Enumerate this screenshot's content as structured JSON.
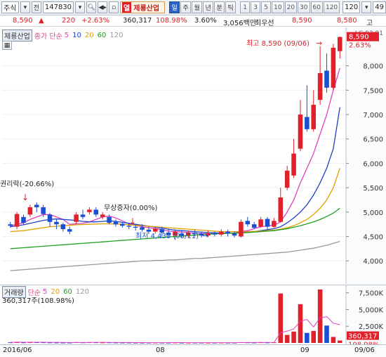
{
  "toolbar": {
    "market_select": "주식",
    "prev_label": "전",
    "code_value": "147830",
    "name_prefix": "열",
    "name_value": "제룡산업",
    "periods": [
      "일",
      "주",
      "월",
      "년",
      "분",
      "틱"
    ],
    "active_period": "일",
    "intervals": [
      "1",
      "3",
      "5",
      "10",
      "20",
      "30",
      "60",
      "120"
    ],
    "interval_select": "120",
    "count_value": "49"
  },
  "quote": {
    "price": "8,590",
    "change_arrow": "▲",
    "change": "220",
    "change_pct": "+2.63%",
    "volume": "360,317",
    "volume_ratio": "108.98%",
    "turnover": "3.60%",
    "amount": "3,056백만",
    "best_ask_label": "최우선",
    "best_ask": "8,590",
    "best_bid": "8,580",
    "high_label": "고"
  },
  "price_pane": {
    "legend_name": "제룡산업",
    "ma_label": "종가 단순",
    "ma_periods": [
      {
        "label": "5",
        "color": "#e040c0"
      },
      {
        "label": "10",
        "color": "#2040c0"
      },
      {
        "label": "20",
        "color": "#e0a000"
      },
      {
        "label": "60",
        "color": "#20a020"
      },
      {
        "label": "120",
        "color": "#999999"
      }
    ],
    "annotations": {
      "high": "최고 8,590 (09/06)",
      "low": "최저 4,430 (08/11)",
      "rights": "권리락(-20.66%)",
      "bonus": "무상증자(0.00%)"
    },
    "last_price_tag": "8,590",
    "last_pct_tag": "2.63%",
    "lc_tag": "LC:93.91"
  },
  "volume_pane": {
    "legend_name": "거래량",
    "ma_label": "단순",
    "ma_periods": [
      {
        "label": "5",
        "color": "#e040c0"
      },
      {
        "label": "20",
        "color": "#e0a000"
      },
      {
        "label": "60",
        "color": "#20a020"
      },
      {
        "label": "120",
        "color": "#999999"
      }
    ],
    "volume_text": "360,317주(108.98%)",
    "last_volume_tag": "360,317",
    "last_ratio_tag": "108.98%"
  },
  "x_axis": {
    "labels": [
      "2016/06",
      "08",
      "09",
      "09/06"
    ]
  },
  "chart_data": [
    {
      "type": "candlestick",
      "title": "제룡산업",
      "y_ticks": [
        4000,
        4500,
        5000,
        5500,
        6000,
        6500,
        7000,
        7500,
        8000
      ],
      "y_tick_labels": [
        "4,000",
        "4,500",
        "5,000",
        "5,500",
        "6,000",
        "6,500",
        "7,000",
        "7,500",
        "8,000"
      ],
      "ylim": [
        3600,
        8700
      ],
      "candles": [
        {
          "o": 4750,
          "c": 4720,
          "h": 4800,
          "l": 4680
        },
        {
          "o": 4700,
          "c": 4960,
          "h": 5000,
          "l": 4650
        },
        {
          "o": 4900,
          "c": 4780,
          "h": 4950,
          "l": 4750
        },
        {
          "o": 4950,
          "c": 5100,
          "h": 5150,
          "l": 4900
        },
        {
          "o": 5150,
          "c": 5100,
          "h": 5200,
          "l": 5000
        },
        {
          "o": 5100,
          "c": 4960,
          "h": 5150,
          "l": 4900
        },
        {
          "o": 4950,
          "c": 4800,
          "h": 4980,
          "l": 4700
        },
        {
          "o": 4800,
          "c": 4750,
          "h": 4850,
          "l": 4650
        },
        {
          "o": 4750,
          "c": 4650,
          "h": 4780,
          "l": 4600
        },
        {
          "o": 4650,
          "c": 4600,
          "h": 4700,
          "l": 4550
        },
        {
          "o": 4800,
          "c": 4950,
          "h": 5000,
          "l": 4750
        },
        {
          "o": 4950,
          "c": 4900,
          "h": 5050,
          "l": 4850
        },
        {
          "o": 5000,
          "c": 5050,
          "h": 5100,
          "l": 4950
        },
        {
          "o": 5050,
          "c": 4950,
          "h": 5100,
          "l": 4900
        },
        {
          "o": 4900,
          "c": 4950,
          "h": 5000,
          "l": 4850
        },
        {
          "o": 4900,
          "c": 4780,
          "h": 4950,
          "l": 4750
        },
        {
          "o": 4800,
          "c": 4750,
          "h": 4850,
          "l": 4700
        },
        {
          "o": 4760,
          "c": 4720,
          "h": 4800,
          "l": 4680
        },
        {
          "o": 4720,
          "c": 4700,
          "h": 4780,
          "l": 4650
        },
        {
          "o": 4700,
          "c": 4680,
          "h": 4760,
          "l": 4620
        },
        {
          "o": 4690,
          "c": 4640,
          "h": 4750,
          "l": 4600
        },
        {
          "o": 4640,
          "c": 4600,
          "h": 4700,
          "l": 4550
        },
        {
          "o": 4600,
          "c": 4660,
          "h": 4700,
          "l": 4560
        },
        {
          "o": 4650,
          "c": 4580,
          "h": 4700,
          "l": 4500
        },
        {
          "o": 4580,
          "c": 4530,
          "h": 4650,
          "l": 4480
        },
        {
          "o": 4520,
          "c": 4600,
          "h": 4650,
          "l": 4430
        },
        {
          "o": 4560,
          "c": 4520,
          "h": 4620,
          "l": 4470
        },
        {
          "o": 4530,
          "c": 4580,
          "h": 4620,
          "l": 4480
        },
        {
          "o": 4580,
          "c": 4560,
          "h": 4640,
          "l": 4500
        },
        {
          "o": 4560,
          "c": 4520,
          "h": 4600,
          "l": 4480
        },
        {
          "o": 4520,
          "c": 4560,
          "h": 4620,
          "l": 4490
        },
        {
          "o": 4560,
          "c": 4540,
          "h": 4600,
          "l": 4500
        },
        {
          "o": 4540,
          "c": 4600,
          "h": 4650,
          "l": 4500
        },
        {
          "o": 4600,
          "c": 4560,
          "h": 4640,
          "l": 4500
        },
        {
          "o": 4560,
          "c": 4520,
          "h": 4600,
          "l": 4480
        },
        {
          "o": 4500,
          "c": 4800,
          "h": 4850,
          "l": 4480
        },
        {
          "o": 4820,
          "c": 4750,
          "h": 4900,
          "l": 4700
        },
        {
          "o": 4750,
          "c": 4680,
          "h": 4800,
          "l": 4650
        },
        {
          "o": 4700,
          "c": 4850,
          "h": 4900,
          "l": 4680
        },
        {
          "o": 4860,
          "c": 4700,
          "h": 4900,
          "l": 4650
        },
        {
          "o": 4700,
          "c": 4820,
          "h": 4880,
          "l": 4680
        },
        {
          "o": 4800,
          "c": 5300,
          "h": 5500,
          "l": 4790
        },
        {
          "o": 5500,
          "c": 5850,
          "h": 5950,
          "l": 5450
        },
        {
          "o": 5750,
          "c": 6200,
          "h": 6500,
          "l": 5700
        },
        {
          "o": 6300,
          "c": 7000,
          "h": 7300,
          "l": 6250
        },
        {
          "o": 6950,
          "c": 6700,
          "h": 7600,
          "l": 6650
        },
        {
          "o": 6700,
          "c": 7200,
          "h": 7500,
          "l": 6650
        },
        {
          "o": 7300,
          "c": 7850,
          "h": 8400,
          "l": 7200
        },
        {
          "o": 7900,
          "c": 7550,
          "h": 8250,
          "l": 7450
        },
        {
          "o": 7550,
          "c": 8370,
          "h": 8450,
          "l": 7500
        },
        {
          "o": 8300,
          "c": 8590,
          "h": 8600,
          "l": 8150
        }
      ],
      "series": [
        {
          "name": "5",
          "values": [
            4720,
            4750,
            4780,
            4850,
            4900,
            4950,
            4950,
            4900,
            4850,
            4750,
            4760,
            4770,
            4800,
            4850,
            4900,
            4920,
            4880,
            4820,
            4760,
            4730,
            4700,
            4680,
            4660,
            4640,
            4610,
            4600,
            4590,
            4580,
            4570,
            4560,
            4560,
            4555,
            4560,
            4570,
            4570,
            4600,
            4620,
            4660,
            4700,
            4720,
            4730,
            4800,
            5000,
            5250,
            5600,
            5900,
            6200,
            6600,
            7000,
            7500,
            7950
          ]
        },
        {
          "name": "10",
          "values": [
            4700,
            4720,
            4740,
            4770,
            4800,
            4830,
            4850,
            4860,
            4850,
            4840,
            4830,
            4810,
            4800,
            4800,
            4810,
            4820,
            4810,
            4790,
            4770,
            4750,
            4730,
            4710,
            4690,
            4670,
            4650,
            4630,
            4620,
            4610,
            4600,
            4590,
            4580,
            4575,
            4570,
            4570,
            4570,
            4580,
            4590,
            4600,
            4620,
            4640,
            4660,
            4700,
            4780,
            4880,
            5000,
            5150,
            5350,
            5600,
            5900,
            6300,
            7150
          ]
        },
        {
          "name": "20",
          "values": [
            4600,
            4610,
            4620,
            4640,
            4660,
            4680,
            4700,
            4710,
            4720,
            4730,
            4740,
            4745,
            4750,
            4755,
            4760,
            4760,
            4755,
            4750,
            4740,
            4730,
            4720,
            4710,
            4700,
            4690,
            4680,
            4670,
            4660,
            4650,
            4640,
            4630,
            4620,
            4610,
            4600,
            4600,
            4600,
            4600,
            4600,
            4605,
            4610,
            4620,
            4630,
            4650,
            4680,
            4720,
            4780,
            4850,
            4950,
            5080,
            5250,
            5500,
            5900
          ]
        },
        {
          "name": "60",
          "values": [
            4250,
            4260,
            4270,
            4280,
            4290,
            4300,
            4310,
            4320,
            4330,
            4340,
            4350,
            4360,
            4370,
            4380,
            4390,
            4400,
            4410,
            4420,
            4430,
            4440,
            4450,
            4460,
            4470,
            4480,
            4490,
            4500,
            4510,
            4520,
            4530,
            4540,
            4550,
            4555,
            4560,
            4565,
            4570,
            4575,
            4580,
            4590,
            4600,
            4610,
            4620,
            4640,
            4660,
            4690,
            4720,
            4760,
            4800,
            4850,
            4910,
            4980,
            5080
          ]
        },
        {
          "name": "120",
          "values": [
            3800,
            3810,
            3820,
            3830,
            3840,
            3850,
            3860,
            3870,
            3880,
            3890,
            3900,
            3910,
            3920,
            3930,
            3940,
            3950,
            3960,
            3970,
            3980,
            3990,
            4000,
            4000,
            4010,
            4010,
            4020,
            4020,
            4030,
            4040,
            4050,
            4050,
            4060,
            4070,
            4080,
            4090,
            4100,
            4110,
            4120,
            4130,
            4140,
            4150,
            4160,
            4170,
            4180,
            4200,
            4220,
            4240,
            4260,
            4290,
            4320,
            4360,
            4400
          ]
        }
      ]
    },
    {
      "type": "bar",
      "title": "거래량",
      "y_ticks": [
        0,
        2500000,
        5000000,
        7500000
      ],
      "y_tick_labels": [
        "",
        "2,500K",
        "5,000K",
        "7,500K"
      ],
      "ylim": [
        0,
        8200000
      ],
      "values": [
        90000,
        150000,
        80000,
        120000,
        100000,
        90000,
        70000,
        60000,
        50000,
        50000,
        120000,
        80000,
        100000,
        90000,
        70000,
        80000,
        60000,
        50000,
        50000,
        40000,
        40000,
        40000,
        50000,
        40000,
        40000,
        60000,
        40000,
        40000,
        40000,
        40000,
        40000,
        40000,
        50000,
        40000,
        40000,
        120000,
        80000,
        60000,
        90000,
        70000,
        90000,
        7400000,
        1200000,
        1700000,
        5800000,
        1500000,
        1800000,
        8000000,
        2600000,
        900000,
        360317
      ]
    }
  ]
}
